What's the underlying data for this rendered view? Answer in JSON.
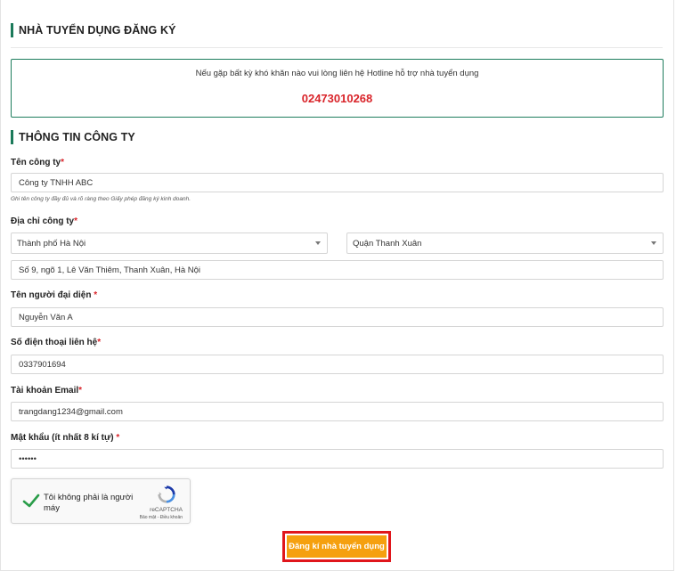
{
  "page": {
    "title": "NHÀ TUYỂN DỤNG ĐĂNG KÝ"
  },
  "hotline": {
    "message": "Nếu gặp bất kỳ khó khăn nào vui lòng liên hệ Hotline hỗ trợ nhà tuyển dụng",
    "number": "02473010268"
  },
  "section": {
    "title": "THÔNG TIN CÔNG TY"
  },
  "form": {
    "company_name": {
      "label": "Tên công ty",
      "required": "*",
      "value": "Công ty TNHH ABC",
      "hint": "Ghi tên công ty đầy đủ và rõ ràng theo Giấy phép đăng ký kinh doanh."
    },
    "company_address": {
      "label": "Địa chỉ công ty",
      "required": "*",
      "city": "Thành phố Hà Nội",
      "district": "Quận Thanh Xuân",
      "street": "Số 9, ngõ 1, Lê Văn Thiêm, Thanh Xuân, Hà Nội"
    },
    "representative": {
      "label": "Tên người đại diện ",
      "required": "*",
      "value": "Nguyễn Văn A"
    },
    "phone": {
      "label": "Số điện thoại liên hệ",
      "required": "*",
      "value": "0337901694"
    },
    "email": {
      "label": "Tài khoản Email",
      "required": "*",
      "value": "trangdang1234@gmail.com"
    },
    "password": {
      "label": "Mật khẩu (ít nhất 8 kí tự) ",
      "required": "*",
      "value": "••••••"
    }
  },
  "captcha": {
    "text": "Tôi không phải là người máy",
    "brand": "reCAPTCHA",
    "terms": "Bảo mật - Điều khoản",
    "checked": true
  },
  "submit": {
    "label": "Đăng kí nhà tuyển dụng"
  },
  "colors": {
    "accent_green": "#1b7a5a",
    "hotline_red": "#d9242a",
    "button_orange": "#f5a00f",
    "highlight_red": "#e0161c"
  }
}
